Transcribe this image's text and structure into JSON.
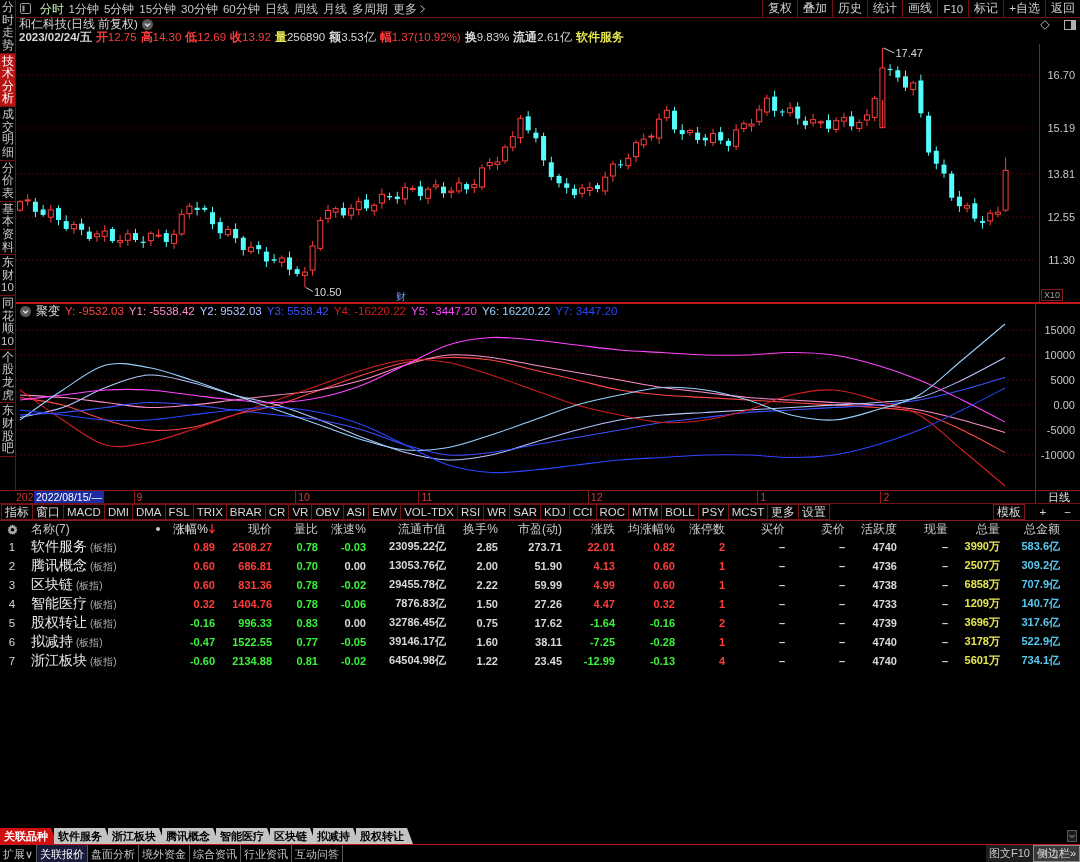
{
  "sidebar": {
    "tabs": [
      {
        "label": "分时走势",
        "selected": false
      },
      {
        "label": "技术分析",
        "selected": true
      },
      {
        "label": "成交明细",
        "selected": false
      },
      {
        "label": "分价表",
        "selected": false
      },
      {
        "label": "基本资料",
        "selected": false
      },
      {
        "label": "东财10",
        "selected": false
      },
      {
        "label": "同花顺10",
        "selected": false
      },
      {
        "label": "个股龙虎",
        "selected": false
      },
      {
        "label": "东财股吧",
        "selected": false
      }
    ]
  },
  "toolbar": {
    "periods": [
      {
        "label": "分时",
        "selected": true
      },
      {
        "label": "1分钟",
        "selected": false
      },
      {
        "label": "5分钟",
        "selected": false
      },
      {
        "label": "15分钟",
        "selected": false
      },
      {
        "label": "30分钟",
        "selected": false
      },
      {
        "label": "60分钟",
        "selected": false
      },
      {
        "label": "日线",
        "selected": false
      },
      {
        "label": "周线",
        "selected": false
      },
      {
        "label": "月线",
        "selected": false
      },
      {
        "label": "多周期",
        "selected": false
      }
    ],
    "more": "更多",
    "actions": [
      "复权",
      "叠加",
      "历史",
      "统计",
      "画线",
      "F10",
      "标记",
      "+自选",
      "返回"
    ]
  },
  "stock": {
    "title": "和仁科技(日线 前复权)",
    "quote": [
      {
        "value": {
          "text": "2023/02/24/五"
        }
      },
      {
        "label": {
          "text": "开",
          "color": "#ff3c3c"
        },
        "value": {
          "text": "12.75",
          "color": "#ff3c3c"
        }
      },
      {
        "label": {
          "text": "高",
          "color": "#ff3c3c"
        },
        "value": {
          "text": "14.30",
          "color": "#ff3c3c"
        }
      },
      {
        "label": {
          "text": "低",
          "color": "#ff3c3c"
        },
        "value": {
          "text": "12.69",
          "color": "#ff3c3c"
        }
      },
      {
        "label": {
          "text": "收",
          "color": "#ff3c3c"
        },
        "value": {
          "text": "13.92",
          "color": "#ff3c3c"
        }
      },
      {
        "label": {
          "text": "量",
          "color": "#e6e650"
        },
        "value": {
          "text": "256890"
        }
      },
      {
        "label": {
          "text": "额"
        },
        "value": {
          "text": "3.53亿"
        }
      },
      {
        "label": {
          "text": "幅",
          "color": "#ff3c3c"
        },
        "value": {
          "text": "1.37(10.92%)",
          "color": "#ff3c3c"
        }
      },
      {
        "label": {
          "text": "换"
        },
        "value": {
          "text": "9.83%"
        }
      },
      {
        "label": {
          "text": "流通"
        },
        "value": {
          "text": "2.61亿"
        }
      },
      {
        "value": {
          "text": "软件服务",
          "color": "#e6e650"
        }
      }
    ]
  },
  "price_chart": {
    "axis_labels": [
      "16.70",
      "15.19",
      "13.81",
      "12.55",
      "11.30"
    ],
    "high_label": "17.47",
    "low_label": "10.50",
    "event_marker": "财",
    "zoom_label": "X10"
  },
  "indicator": {
    "name": "聚变",
    "legend": [
      {
        "text": "Y: -9532.03",
        "color": "#ff4646"
      },
      {
        "text": "Y1: -5538.42",
        "color": "#ff8cc8"
      },
      {
        "text": "Y2: 9532.03",
        "color": "#b4c8ff"
      },
      {
        "text": "Y3: 5538.42",
        "color": "#3c50ff"
      },
      {
        "text": "Y4: -16220.22",
        "color": "#d21e1e"
      },
      {
        "text": "Y5: -3447.20",
        "color": "#ff46ff"
      },
      {
        "text": "Y6: 16220.22",
        "color": "#96d2ff"
      },
      {
        "text": "Y7: 3447.20",
        "color": "#2846ff"
      }
    ],
    "chart_data": {
      "type": "line",
      "grid": true,
      "ylim": [
        -17000,
        20200
      ],
      "yticks": [
        15000,
        10000,
        5000,
        {
          "value": 0,
          "label": "0.00"
        },
        -5000,
        -10000
      ],
      "series": [
        {
          "color": "#ff4646",
          "values": [
            1500,
            0,
            -3000,
            -5000,
            -4500,
            -2000,
            0,
            3000,
            6000,
            8500,
            9500,
            9000,
            7000,
            5000,
            3000,
            2000,
            1500,
            1000,
            500,
            0,
            -500,
            -1500,
            -5000,
            -9500
          ]
        },
        {
          "color": "#ff8cc8",
          "values": [
            2000,
            1500,
            500,
            -500,
            0,
            1000,
            2000,
            3000,
            5000,
            8000,
            10000,
            9500,
            8000,
            6500,
            5000,
            3500,
            2500,
            1500,
            1000,
            500,
            0,
            -1000,
            -3000,
            -5500
          ]
        },
        {
          "color": "#b4c8ff",
          "values": [
            -2500,
            -500,
            3500,
            6000,
            4500,
            2000,
            0,
            -3000,
            -6500,
            -9500,
            -11000,
            -10000,
            -7500,
            -5000,
            -3000,
            -2000,
            -1500,
            -1000,
            -500,
            0,
            500,
            1500,
            5000,
            9500
          ]
        },
        {
          "color": "#3c50ff",
          "values": [
            -2000,
            -1500,
            -500,
            500,
            0,
            -1000,
            -2000,
            -3000,
            -5000,
            -8000,
            -10000,
            -9500,
            -8000,
            -6500,
            -5000,
            -3500,
            -2500,
            -1500,
            -1000,
            -500,
            0,
            1000,
            3000,
            5500
          ]
        },
        {
          "color": "#d21e1e",
          "values": [
            3000,
            -3000,
            -8000,
            -7500,
            -5000,
            -2000,
            1000,
            4000,
            7000,
            9000,
            8500,
            6000,
            3000,
            0,
            -2000,
            -3500,
            -3000,
            -1000,
            2000,
            3000,
            1000,
            -2000,
            -9000,
            -16200
          ]
        },
        {
          "color": "#ff46ff",
          "values": [
            1000,
            2000,
            3000,
            3000,
            2000,
            1000,
            500,
            1500,
            4000,
            8000,
            12000,
            13500,
            13000,
            12000,
            11000,
            10500,
            10000,
            10000,
            10500,
            10000,
            8000,
            5000,
            1000,
            -3400
          ]
        },
        {
          "color": "#96d2ff",
          "values": [
            -3000,
            3000,
            8000,
            7500,
            5000,
            2000,
            -1000,
            -4000,
            -7000,
            -9000,
            -8500,
            -6000,
            -3000,
            0,
            2000,
            3500,
            3000,
            1000,
            -2000,
            -3000,
            -1000,
            2000,
            9000,
            16200
          ]
        },
        {
          "color": "#2846ff",
          "values": [
            -1000,
            -2000,
            -3000,
            -3000,
            -2000,
            -1000,
            -500,
            -1500,
            -4000,
            -8000,
            -12000,
            -13500,
            -13000,
            -12000,
            -11000,
            -10500,
            -10000,
            -10000,
            -10500,
            -10000,
            -8000,
            -5000,
            -1000,
            3400
          ]
        }
      ]
    }
  },
  "date_axis": {
    "start_label": "202",
    "cursor_label": "2022/08/15/—",
    "months": [
      "9",
      "10",
      "11",
      "12",
      "1",
      "2"
    ],
    "period": "日线"
  },
  "indicator_tabs": {
    "tabs": [
      "指标",
      "窗口",
      "MACD",
      "DMI",
      "DMA",
      "FSL",
      "TRIX",
      "BRAR",
      "CR",
      "VR",
      "OBV",
      "ASI",
      "EMV",
      "VOL-TDX",
      "RSI",
      "WR",
      "SAR",
      "KDJ",
      "CCI",
      "ROC",
      "MTM",
      "BOLL",
      "PSY",
      "MCST",
      "更多",
      "设置"
    ],
    "actions": [
      "模板",
      "+",
      "−"
    ]
  },
  "quote_table": {
    "columns": [
      {
        "label": "名称(7)",
        "sorted": false
      },
      {
        "label": "涨幅%",
        "sorted": true
      },
      {
        "label": "现价",
        "sorted": false
      },
      {
        "label": "量比",
        "sorted": false
      },
      {
        "label": "涨速%",
        "sorted": false
      },
      {
        "label": "流通市值",
        "sorted": false
      },
      {
        "label": "换手%",
        "sorted": false
      },
      {
        "label": "市盈(动)",
        "sorted": false
      },
      {
        "label": "涨跌",
        "sorted": false
      },
      {
        "label": "均涨幅%",
        "sorted": false
      },
      {
        "label": "涨停数",
        "sorted": false
      },
      {
        "label": "买价",
        "sorted": false
      },
      {
        "label": "卖价",
        "sorted": false
      },
      {
        "label": "活跃度",
        "sorted": false
      },
      {
        "label": "现量",
        "sorted": false
      },
      {
        "label": "总量",
        "sorted": false
      },
      {
        "label": "总金额",
        "sorted": false
      }
    ],
    "rows": [
      {
        "index": "1",
        "cells": [
          {
            "text": "软件服务",
            "tag": "(板指)"
          },
          {
            "text": "0.89",
            "color": "#ff3c3c"
          },
          {
            "text": "2508.27",
            "color": "#ff3c3c"
          },
          {
            "text": "0.78",
            "color": "#3cf03c"
          },
          {
            "text": "-0.03",
            "color": "#3cf03c"
          },
          {
            "text": "23095.22亿"
          },
          {
            "text": "2.85"
          },
          {
            "text": "273.71"
          },
          {
            "text": "22.01",
            "color": "#ff3c3c"
          },
          {
            "text": "0.82",
            "color": "#ff3c3c"
          },
          {
            "text": "2",
            "color": "#ff3c3c"
          },
          {
            "text": "–"
          },
          {
            "text": "–"
          },
          {
            "text": "4740"
          },
          {
            "text": "–"
          },
          {
            "text": "3990万",
            "color": "#e6e650"
          },
          {
            "text": "583.6亿",
            "color": "#5ac8f0"
          }
        ]
      },
      {
        "index": "2",
        "cells": [
          {
            "text": "腾讯概念",
            "tag": "(板指)"
          },
          {
            "text": "0.60",
            "color": "#ff3c3c"
          },
          {
            "text": "686.81",
            "color": "#ff3c3c"
          },
          {
            "text": "0.70",
            "color": "#3cf03c"
          },
          {
            "text": "0.00"
          },
          {
            "text": "13053.76亿"
          },
          {
            "text": "2.00"
          },
          {
            "text": "51.90"
          },
          {
            "text": "4.13",
            "color": "#ff3c3c"
          },
          {
            "text": "0.60",
            "color": "#ff3c3c"
          },
          {
            "text": "1",
            "color": "#ff3c3c"
          },
          {
            "text": "–"
          },
          {
            "text": "–"
          },
          {
            "text": "4736"
          },
          {
            "text": "–"
          },
          {
            "text": "2507万",
            "color": "#e6e650"
          },
          {
            "text": "309.2亿",
            "color": "#5ac8f0"
          }
        ]
      },
      {
        "index": "3",
        "cells": [
          {
            "text": "区块链",
            "tag": "(板指)"
          },
          {
            "text": "0.60",
            "color": "#ff3c3c"
          },
          {
            "text": "831.36",
            "color": "#ff3c3c"
          },
          {
            "text": "0.78",
            "color": "#3cf03c"
          },
          {
            "text": "-0.02",
            "color": "#3cf03c"
          },
          {
            "text": "29455.78亿"
          },
          {
            "text": "2.22"
          },
          {
            "text": "59.99"
          },
          {
            "text": "4.99",
            "color": "#ff3c3c"
          },
          {
            "text": "0.60",
            "color": "#ff3c3c"
          },
          {
            "text": "1",
            "color": "#ff3c3c"
          },
          {
            "text": "–"
          },
          {
            "text": "–"
          },
          {
            "text": "4738"
          },
          {
            "text": "–"
          },
          {
            "text": "6858万",
            "color": "#e6e650"
          },
          {
            "text": "707.9亿",
            "color": "#5ac8f0"
          }
        ]
      },
      {
        "index": "4",
        "cells": [
          {
            "text": "智能医疗",
            "tag": "(板指)"
          },
          {
            "text": "0.32",
            "color": "#ff3c3c"
          },
          {
            "text": "1404.76",
            "color": "#ff3c3c"
          },
          {
            "text": "0.78",
            "color": "#3cf03c"
          },
          {
            "text": "-0.06",
            "color": "#3cf03c"
          },
          {
            "text": "7876.83亿"
          },
          {
            "text": "1.50"
          },
          {
            "text": "27.26"
          },
          {
            "text": "4.47",
            "color": "#ff3c3c"
          },
          {
            "text": "0.32",
            "color": "#ff3c3c"
          },
          {
            "text": "1",
            "color": "#ff3c3c"
          },
          {
            "text": "–"
          },
          {
            "text": "–"
          },
          {
            "text": "4733"
          },
          {
            "text": "–"
          },
          {
            "text": "1209万",
            "color": "#e6e650"
          },
          {
            "text": "140.7亿",
            "color": "#5ac8f0"
          }
        ]
      },
      {
        "index": "5",
        "cells": [
          {
            "text": "股权转让",
            "tag": "(板指)"
          },
          {
            "text": "-0.16",
            "color": "#3cf03c"
          },
          {
            "text": "996.33",
            "color": "#3cf03c"
          },
          {
            "text": "0.83",
            "color": "#3cf03c"
          },
          {
            "text": "0.00"
          },
          {
            "text": "32786.45亿"
          },
          {
            "text": "0.75"
          },
          {
            "text": "17.62"
          },
          {
            "text": "-1.64",
            "color": "#3cf03c"
          },
          {
            "text": "-0.16",
            "color": "#3cf03c"
          },
          {
            "text": "2",
            "color": "#ff3c3c"
          },
          {
            "text": "–"
          },
          {
            "text": "–"
          },
          {
            "text": "4739"
          },
          {
            "text": "–"
          },
          {
            "text": "3696万",
            "color": "#e6e650"
          },
          {
            "text": "317.6亿",
            "color": "#5ac8f0"
          }
        ]
      },
      {
        "index": "6",
        "cells": [
          {
            "text": "拟减持",
            "tag": "(板指)"
          },
          {
            "text": "-0.47",
            "color": "#3cf03c"
          },
          {
            "text": "1522.55",
            "color": "#3cf03c"
          },
          {
            "text": "0.77",
            "color": "#3cf03c"
          },
          {
            "text": "-0.05",
            "color": "#3cf03c"
          },
          {
            "text": "39146.17亿"
          },
          {
            "text": "1.60"
          },
          {
            "text": "38.11"
          },
          {
            "text": "-7.25",
            "color": "#3cf03c"
          },
          {
            "text": "-0.28",
            "color": "#3cf03c"
          },
          {
            "text": "1",
            "color": "#ff3c3c"
          },
          {
            "text": "–"
          },
          {
            "text": "–"
          },
          {
            "text": "4740"
          },
          {
            "text": "–"
          },
          {
            "text": "3178万",
            "color": "#e6e650"
          },
          {
            "text": "522.9亿",
            "color": "#5ac8f0"
          }
        ]
      },
      {
        "index": "7",
        "cells": [
          {
            "text": "浙江板块",
            "tag": "(板指)"
          },
          {
            "text": "-0.60",
            "color": "#3cf03c"
          },
          {
            "text": "2134.88",
            "color": "#3cf03c"
          },
          {
            "text": "0.81",
            "color": "#3cf03c"
          },
          {
            "text": "-0.02",
            "color": "#3cf03c"
          },
          {
            "text": "64504.98亿"
          },
          {
            "text": "1.22"
          },
          {
            "text": "23.45"
          },
          {
            "text": "-12.99",
            "color": "#3cf03c"
          },
          {
            "text": "-0.13",
            "color": "#3cf03c"
          },
          {
            "text": "4",
            "color": "#ff3c3c"
          },
          {
            "text": "–"
          },
          {
            "text": "–"
          },
          {
            "text": "4740"
          },
          {
            "text": "–"
          },
          {
            "text": "5601万",
            "color": "#e6e650"
          },
          {
            "text": "734.1亿",
            "color": "#5ac8f0"
          }
        ]
      }
    ]
  },
  "related_tabs": [
    {
      "label": "关联品种",
      "selected": true
    },
    {
      "label": "软件服务",
      "selected": false
    },
    {
      "label": "浙江板块",
      "selected": false
    },
    {
      "label": "腾讯概念",
      "selected": false
    },
    {
      "label": "智能医疗",
      "selected": false
    },
    {
      "label": "区块链",
      "selected": false
    },
    {
      "label": "拟减持",
      "selected": false
    },
    {
      "label": "股权转让",
      "selected": false
    }
  ],
  "status_bar": {
    "tabs": [
      {
        "label": "扩展∨",
        "selected": false
      },
      {
        "label": "关联报价",
        "selected": true
      },
      {
        "label": "盘面分析",
        "selected": false
      },
      {
        "label": "境外资金",
        "selected": false
      },
      {
        "label": "综合资讯",
        "selected": false
      },
      {
        "label": "行业资讯",
        "selected": false
      },
      {
        "label": "互动问答",
        "selected": false
      }
    ],
    "right": [
      "图文F10",
      "侧边栏»"
    ]
  }
}
